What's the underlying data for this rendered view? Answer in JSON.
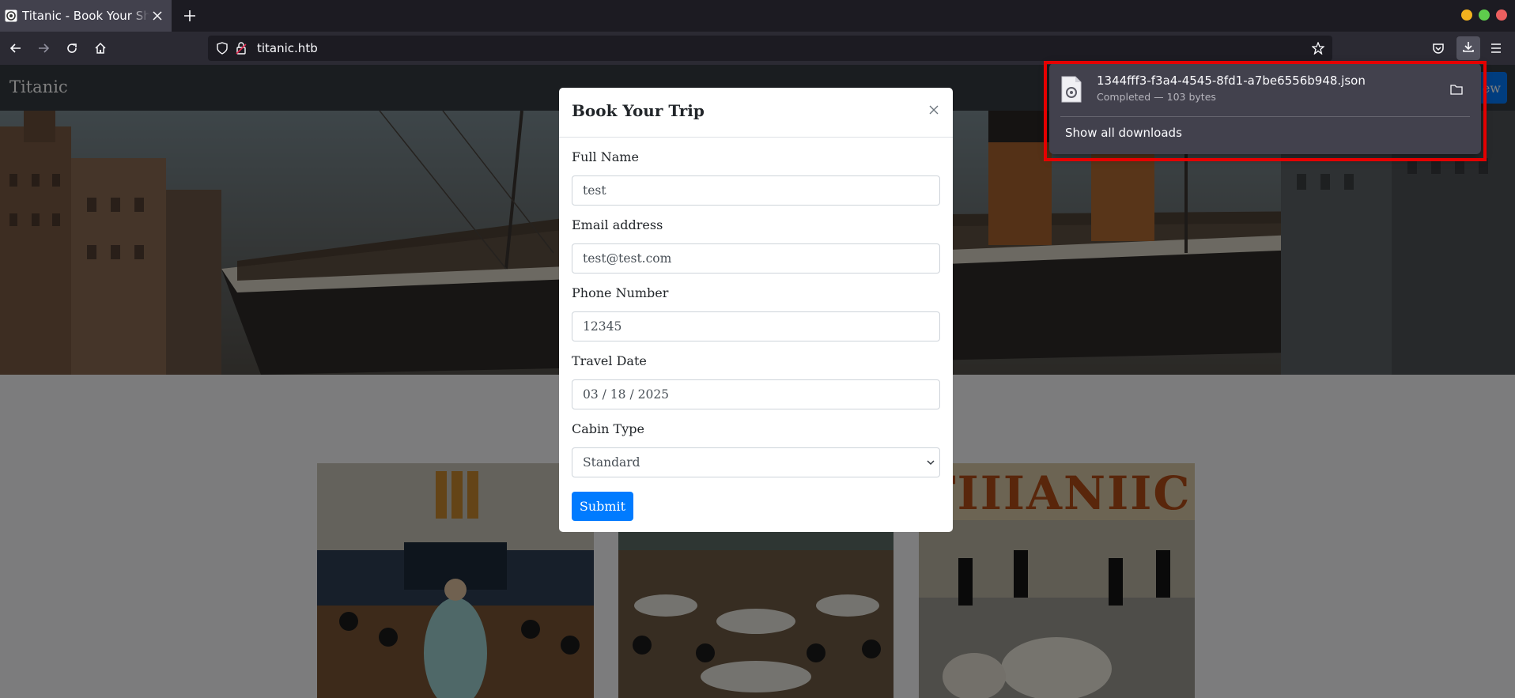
{
  "browser": {
    "tab_title": "Titanic - Book Your Ship Trip",
    "url": "titanic.htb",
    "colors": {
      "window_close": "#ec5f5f",
      "window_maximize": "#5ecc4c",
      "window_minimize": "#f2b21e"
    }
  },
  "site": {
    "brand": "Titanic",
    "cta_label": "Book Now",
    "accent_color": "#007bff"
  },
  "modal": {
    "title": "Book Your Trip",
    "fields": [
      {
        "label": "Full Name",
        "value": "test"
      },
      {
        "label": "Email address",
        "value": "test@test.com"
      },
      {
        "label": "Phone Number",
        "value": "12345"
      },
      {
        "label": "Travel Date",
        "value": "03 / 18 / 2025"
      },
      {
        "label": "Cabin Type",
        "value": "Standard"
      }
    ],
    "submit_label": "Submit"
  },
  "downloads": {
    "filename": "1344fff3-f3a4-4545-8fd1-a7be6556b948.json",
    "status": "Completed — 103 bytes",
    "show_all_label": "Show all downloads",
    "highlight_color": "#e50000"
  }
}
